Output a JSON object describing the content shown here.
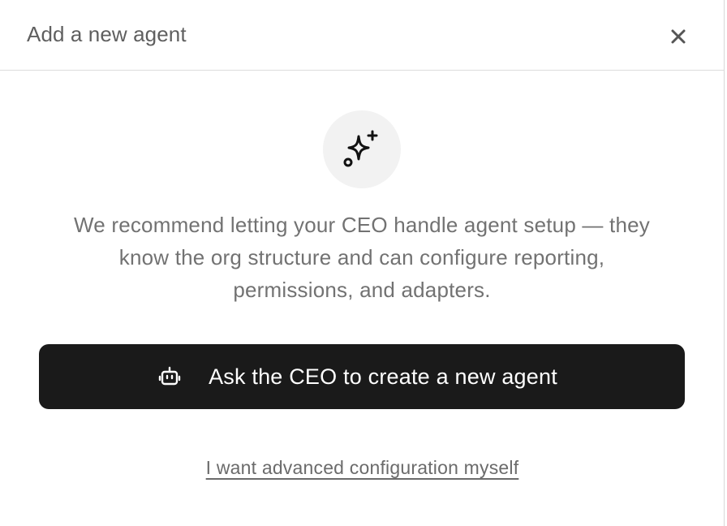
{
  "dialog": {
    "title": "Add a new agent",
    "close_icon": "close-icon",
    "hero_icon": "sparkles-icon",
    "description_lines": [
      "We recommend letting your CEO handle agent setup — they",
      "know the org structure and can configure reporting,",
      "permissions, and adapters."
    ],
    "primary_button": {
      "icon": "robot-icon",
      "label": "Ask the CEO to create a new agent"
    },
    "advanced_link": "I want advanced configuration myself"
  },
  "colors": {
    "button_bg": "#1a1a1a",
    "icon_circle_bg": "#f2f2f2",
    "text_muted": "#727272"
  }
}
